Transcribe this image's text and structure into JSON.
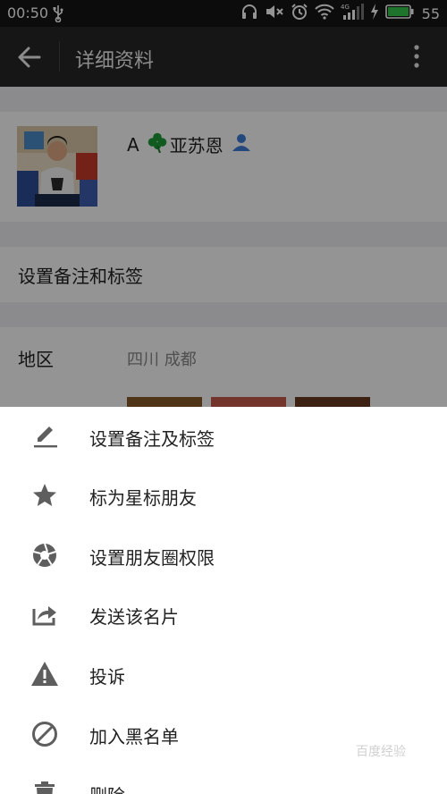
{
  "status_bar": {
    "time": "00:50",
    "battery": "55",
    "network": "4G"
  },
  "title_bar": {
    "title": "详细资料"
  },
  "profile": {
    "name": "A",
    "name_suffix": "亚苏恩"
  },
  "remark_row": {
    "label": "设置备注和标签"
  },
  "region_row": {
    "label": "地区",
    "value": "四川  成都"
  },
  "menu": {
    "items": [
      {
        "label": "设置备注及标签",
        "icon": "pencil-icon"
      },
      {
        "label": "标为星标朋友",
        "icon": "star-icon"
      },
      {
        "label": "设置朋友圈权限",
        "icon": "aperture-icon"
      },
      {
        "label": "发送该名片",
        "icon": "share-icon"
      },
      {
        "label": "投诉",
        "icon": "warning-icon"
      },
      {
        "label": "加入黑名单",
        "icon": "block-icon"
      },
      {
        "label": "删除",
        "icon": "trash-icon"
      }
    ]
  },
  "watermark": "百度经验",
  "colors": {
    "title_bar": "#262628",
    "status_bar": "#161616",
    "icon_gray": "#5e5e5e",
    "person_icon_blue": "#3b7dd8",
    "clover_green": "#1e9e3a",
    "battery_green": "#35c94a"
  }
}
